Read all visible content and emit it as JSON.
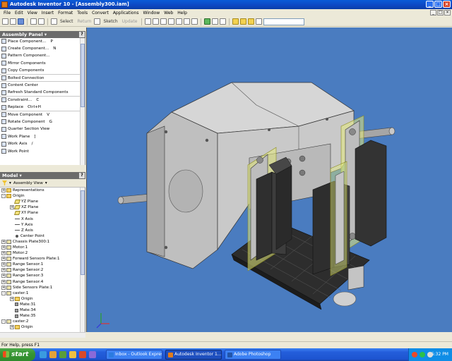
{
  "window": {
    "title": "Autodesk Inventor 10 - [Assembly300.iam]"
  },
  "menu": [
    "File",
    "Edit",
    "View",
    "Insert",
    "Format",
    "Tools",
    "Convert",
    "Applications",
    "Window",
    "Web",
    "Help"
  ],
  "toolbar": {
    "select_label": "Select",
    "return_label": "Return",
    "sketch_label": "Sketch",
    "update_label": "Update"
  },
  "assembly_panel": {
    "title": "Assembly Panel",
    "items": [
      {
        "label": "Place Component...",
        "shortcut": "P"
      },
      {
        "label": "Create Component...",
        "shortcut": "N"
      },
      {
        "label": "Pattern Component...",
        "shortcut": ""
      },
      {
        "label": "Mirror Components",
        "shortcut": ""
      },
      {
        "label": "Copy Components",
        "shortcut": ""
      },
      {
        "label": "Bolted Connection",
        "shortcut": ""
      },
      {
        "label": "Content Center",
        "shortcut": ""
      },
      {
        "label": "Refresh Standard Components",
        "shortcut": ""
      },
      {
        "label": "Constraint...",
        "shortcut": "C"
      },
      {
        "label": "Replace",
        "shortcut": "Ctrl+H"
      },
      {
        "label": "Move Component",
        "shortcut": "V"
      },
      {
        "label": "Rotate Component",
        "shortcut": "G"
      },
      {
        "label": "Quarter Section View",
        "shortcut": ""
      },
      {
        "label": "Work Plane",
        "shortcut": "]"
      },
      {
        "label": "Work Axis",
        "shortcut": "/"
      },
      {
        "label": "Work Point",
        "shortcut": ""
      }
    ]
  },
  "model_panel": {
    "title": "Model",
    "view_label": "Assembly View",
    "tree": [
      {
        "label": "Representations",
        "level": 0,
        "exp": "+",
        "icon": "folder"
      },
      {
        "label": "Origin",
        "level": 0,
        "exp": "-",
        "icon": "folder"
      },
      {
        "label": "YZ Plane",
        "level": 1,
        "exp": "",
        "icon": "plane"
      },
      {
        "label": "XZ Plane",
        "level": 1,
        "exp": "+",
        "icon": "plane"
      },
      {
        "label": "XY Plane",
        "level": 1,
        "exp": "",
        "icon": "plane"
      },
      {
        "label": "X Axis",
        "level": 1,
        "exp": "",
        "icon": "axis"
      },
      {
        "label": "Y Axis",
        "level": 1,
        "exp": "",
        "icon": "axis"
      },
      {
        "label": "Z Axis",
        "level": 1,
        "exp": "",
        "icon": "axis"
      },
      {
        "label": "Center Point",
        "level": 1,
        "exp": "",
        "icon": "point"
      },
      {
        "label": "Chassis Plate300:1",
        "level": 0,
        "exp": "+",
        "icon": "part"
      },
      {
        "label": "Motor:1",
        "level": 0,
        "exp": "+",
        "icon": "part"
      },
      {
        "label": "Motor:2",
        "level": 0,
        "exp": "+",
        "icon": "part"
      },
      {
        "label": "Forward Sensors Plate:1",
        "level": 0,
        "exp": "+",
        "icon": "part"
      },
      {
        "label": "Range Sensor:1",
        "level": 0,
        "exp": "+",
        "icon": "part"
      },
      {
        "label": "Range Sensor:2",
        "level": 0,
        "exp": "+",
        "icon": "part"
      },
      {
        "label": "Range Sensor:3",
        "level": 0,
        "exp": "+",
        "icon": "part"
      },
      {
        "label": "Range Sensor:4",
        "level": 0,
        "exp": "+",
        "icon": "part"
      },
      {
        "label": "Side Sensors Plate:1",
        "level": 0,
        "exp": "+",
        "icon": "part"
      },
      {
        "label": "caster:1",
        "level": 0,
        "exp": "-",
        "icon": "part"
      },
      {
        "label": "Origin",
        "level": 1,
        "exp": "+",
        "icon": "folder"
      },
      {
        "label": "Mate:31",
        "level": 1,
        "exp": "",
        "icon": "mate"
      },
      {
        "label": "Mate:34",
        "level": 1,
        "exp": "",
        "icon": "mate"
      },
      {
        "label": "Mate:35",
        "level": 1,
        "exp": "",
        "icon": "mate"
      },
      {
        "label": "caster:2",
        "level": 0,
        "exp": "-",
        "icon": "part"
      },
      {
        "label": "Origin",
        "level": 1,
        "exp": "+",
        "icon": "folder"
      }
    ]
  },
  "status": {
    "text": "For Help, press F1"
  },
  "taskbar": {
    "start_label": "start",
    "tasks": [
      {
        "label": "Inbox - Outlook Express",
        "color": "#2b7be0",
        "active": false
      },
      {
        "label": "Autodesk Inventor 1...",
        "color": "#e07b1a",
        "active": true
      },
      {
        "label": "Adobe Photoshop",
        "color": "#2255aa",
        "active": false
      }
    ],
    "clock": "5:32 PM"
  },
  "colors": {
    "viewport_bg": "#4a7cc0",
    "title_bar": "#0d47c2",
    "start_green": "#379634"
  }
}
